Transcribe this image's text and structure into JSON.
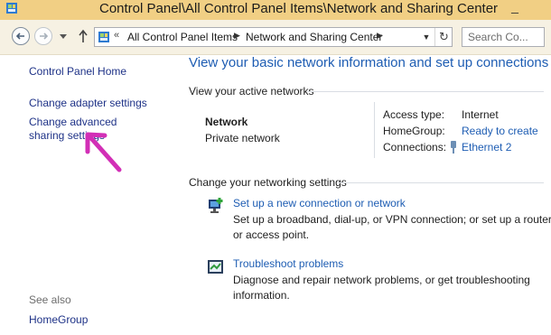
{
  "window": {
    "title": "Control Panel\\All Control Panel Items\\Network and Sharing Center"
  },
  "navbar": {
    "breadcrumbs": [
      "All Control Panel Items",
      "Network and Sharing Center"
    ],
    "overflow_glyph": "«",
    "search_placeholder": "Search Co..."
  },
  "sidebar": {
    "home": "Control Panel Home",
    "links": [
      "Change adapter settings",
      "Change advanced sharing settings"
    ],
    "see_also_heading": "See also",
    "see_also": [
      "HomeGroup"
    ]
  },
  "main": {
    "title": "View your basic network information and set up connections",
    "active_heading": "View your active networks",
    "network": {
      "name": "Network",
      "type": "Private network",
      "access_label": "Access type:",
      "access_value": "Internet",
      "homegroup_label": "HomeGroup:",
      "homegroup_value": "Ready to create",
      "connections_label": "Connections:",
      "connections_value": "Ethernet 2"
    },
    "change_heading": "Change your networking settings",
    "tasks": [
      {
        "title": "Set up a new connection or network",
        "description": "Set up a broadband, dial-up, or VPN connection; or set up a router or access point.",
        "icon": "network-setup-icon"
      },
      {
        "title": "Troubleshoot problems",
        "description": "Diagnose and repair network problems, or get troubleshooting information.",
        "icon": "troubleshoot-icon"
      }
    ]
  },
  "colors": {
    "titlebar": "#f1cf84",
    "link": "#1e3287",
    "heading_blue": "#1e5db3",
    "annotation_arrow": "#d22fb6"
  }
}
